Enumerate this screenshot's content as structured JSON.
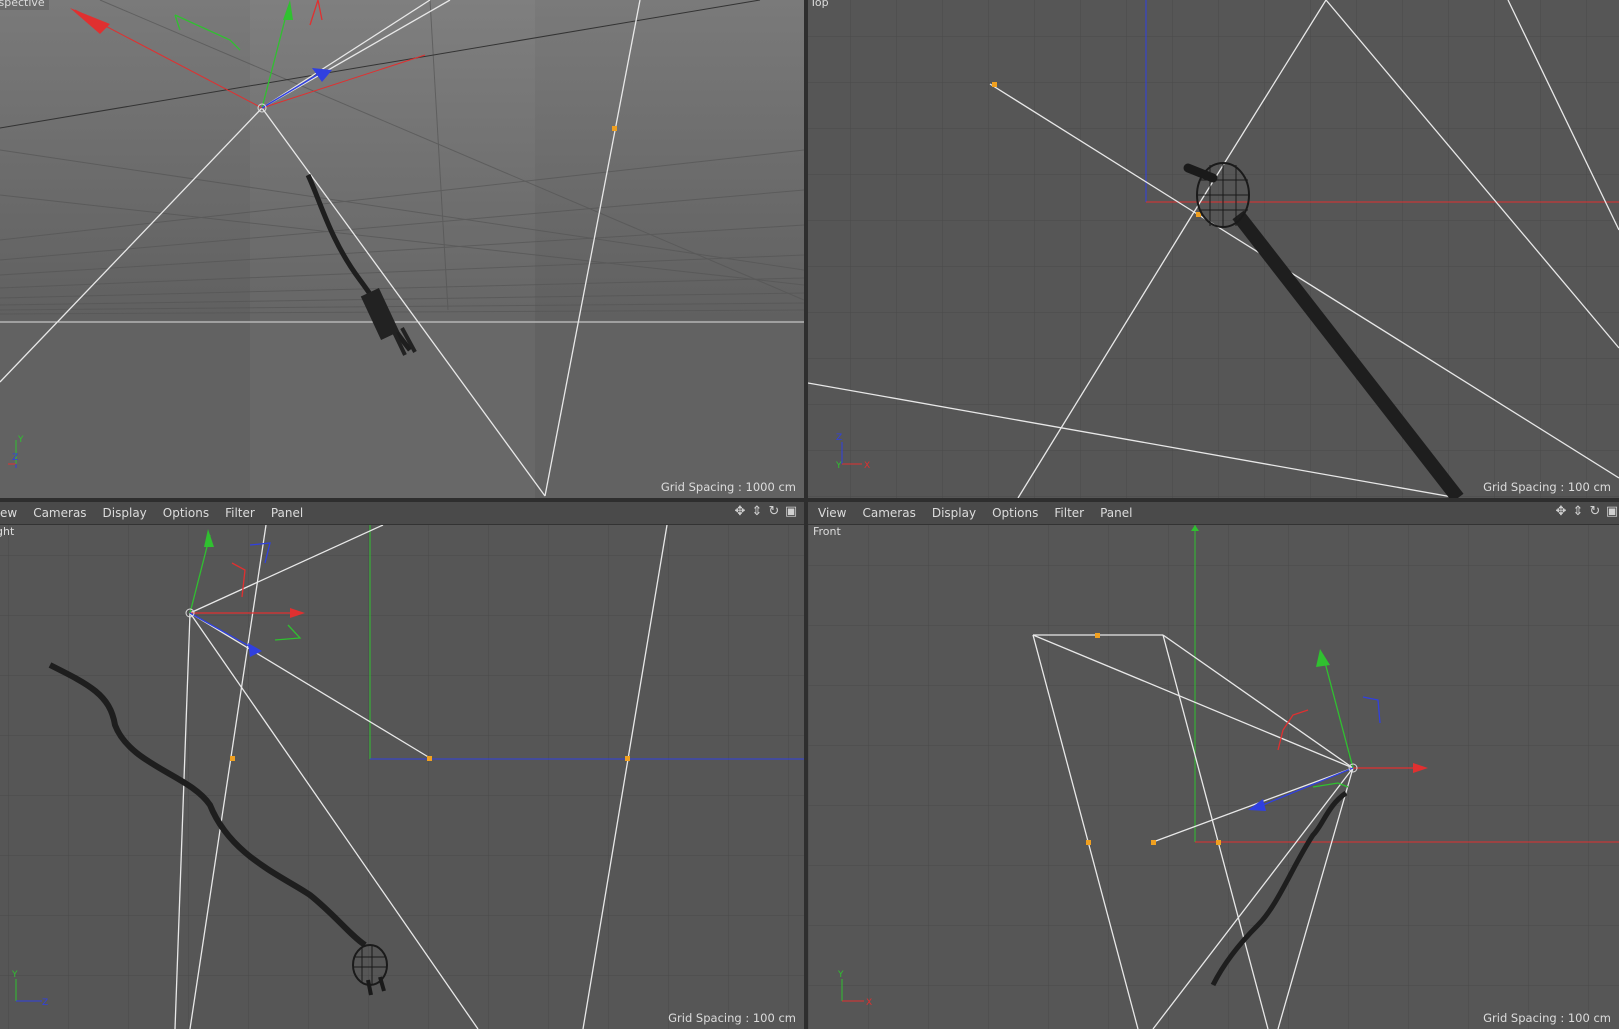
{
  "viewports": {
    "perspective": {
      "label": "rspective",
      "grid_spacing": "Grid Spacing : 1000 cm"
    },
    "top": {
      "label": "Top",
      "grid_spacing": "Grid Spacing : 100 cm"
    },
    "right": {
      "label": "ght",
      "grid_spacing": "Grid Spacing : 100 cm"
    },
    "front": {
      "label": "Front",
      "grid_spacing": "Grid Spacing : 100 cm"
    }
  },
  "menu": {
    "left": [
      "ew",
      "Cameras",
      "Display",
      "Options",
      "Filter",
      "Panel"
    ],
    "right": [
      "View",
      "Cameras",
      "Display",
      "Options",
      "Filter",
      "Panel"
    ]
  },
  "axis_labels": {
    "x": "X",
    "y": "Y",
    "z": "Z"
  },
  "icons": [
    "move-view-icon",
    "dolly-view-icon",
    "rotate-view-icon",
    "maximize-view-icon"
  ],
  "colors": {
    "x_axis": "#e03030",
    "y_axis": "#30c030",
    "z_axis": "#3040e0",
    "point": "#f0a020",
    "line": "#e8e8e8"
  }
}
